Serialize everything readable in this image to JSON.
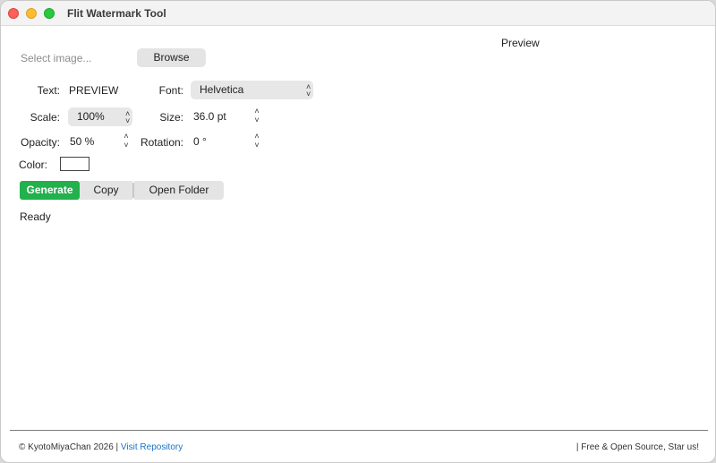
{
  "window": {
    "title": "Flit Watermark Tool"
  },
  "file": {
    "placeholder": "Select image...",
    "browse_label": "Browse"
  },
  "preview": {
    "label": "Preview"
  },
  "text_row": {
    "label": "Text:",
    "value": "PREVIEW",
    "font_label": "Font:",
    "font_value": "Helvetica"
  },
  "scale_row": {
    "label": "Scale:",
    "value": "100%",
    "size_label": "Size:",
    "size_value": "36.0 pt"
  },
  "opacity_row": {
    "label": "Opacity:",
    "value": "50 %",
    "rotation_label": "Rotation:",
    "rotation_value": "0 °"
  },
  "color_row": {
    "label": "Color:",
    "value": "#ffffff"
  },
  "actions": {
    "generate": "Generate",
    "copy": "Copy",
    "open_folder": "Open Folder"
  },
  "status": {
    "text": "Ready"
  },
  "footer": {
    "copyright": "© KyotoMiyaChan 2026 |",
    "repo_link": "Visit Repository",
    "right": "| Free & Open Source, Star us!"
  },
  "colors": {
    "accent_generate": "#22b14c",
    "link": "#1a73c9"
  },
  "icons": [
    "chevron-updown-icon",
    "stepper-up-icon",
    "stepper-down-icon"
  ]
}
